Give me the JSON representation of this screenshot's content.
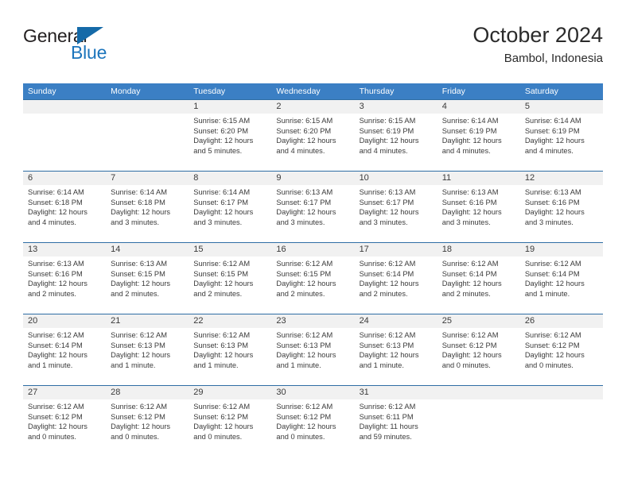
{
  "brand": {
    "name_top": "General",
    "name_bottom": "Blue",
    "flag_icon": "triangle-flag-icon",
    "color_dark": "#231f20",
    "color_blue": "#1c75bc"
  },
  "header": {
    "title": "October 2024",
    "subtitle": "Bambol, Indonesia"
  },
  "colors": {
    "header_row_bg": "#3b7fc4",
    "row_separator": "#2e6da4",
    "day_band_bg": "#f1f1f1",
    "text": "#3a3a3a"
  },
  "weekdays": [
    "Sunday",
    "Monday",
    "Tuesday",
    "Wednesday",
    "Thursday",
    "Friday",
    "Saturday"
  ],
  "weeks": [
    [
      {
        "day": "",
        "sunrise": "",
        "sunset": "",
        "daylight_line1": "",
        "daylight_line2": "",
        "empty": true
      },
      {
        "day": "",
        "sunrise": "",
        "sunset": "",
        "daylight_line1": "",
        "daylight_line2": "",
        "empty": true
      },
      {
        "day": "1",
        "sunrise": "Sunrise: 6:15 AM",
        "sunset": "Sunset: 6:20 PM",
        "daylight_line1": "Daylight: 12 hours",
        "daylight_line2": "and 5 minutes."
      },
      {
        "day": "2",
        "sunrise": "Sunrise: 6:15 AM",
        "sunset": "Sunset: 6:20 PM",
        "daylight_line1": "Daylight: 12 hours",
        "daylight_line2": "and 4 minutes."
      },
      {
        "day": "3",
        "sunrise": "Sunrise: 6:15 AM",
        "sunset": "Sunset: 6:19 PM",
        "daylight_line1": "Daylight: 12 hours",
        "daylight_line2": "and 4 minutes."
      },
      {
        "day": "4",
        "sunrise": "Sunrise: 6:14 AM",
        "sunset": "Sunset: 6:19 PM",
        "daylight_line1": "Daylight: 12 hours",
        "daylight_line2": "and 4 minutes."
      },
      {
        "day": "5",
        "sunrise": "Sunrise: 6:14 AM",
        "sunset": "Sunset: 6:19 PM",
        "daylight_line1": "Daylight: 12 hours",
        "daylight_line2": "and 4 minutes."
      }
    ],
    [
      {
        "day": "6",
        "sunrise": "Sunrise: 6:14 AM",
        "sunset": "Sunset: 6:18 PM",
        "daylight_line1": "Daylight: 12 hours",
        "daylight_line2": "and 4 minutes."
      },
      {
        "day": "7",
        "sunrise": "Sunrise: 6:14 AM",
        "sunset": "Sunset: 6:18 PM",
        "daylight_line1": "Daylight: 12 hours",
        "daylight_line2": "and 3 minutes."
      },
      {
        "day": "8",
        "sunrise": "Sunrise: 6:14 AM",
        "sunset": "Sunset: 6:17 PM",
        "daylight_line1": "Daylight: 12 hours",
        "daylight_line2": "and 3 minutes."
      },
      {
        "day": "9",
        "sunrise": "Sunrise: 6:13 AM",
        "sunset": "Sunset: 6:17 PM",
        "daylight_line1": "Daylight: 12 hours",
        "daylight_line2": "and 3 minutes."
      },
      {
        "day": "10",
        "sunrise": "Sunrise: 6:13 AM",
        "sunset": "Sunset: 6:17 PM",
        "daylight_line1": "Daylight: 12 hours",
        "daylight_line2": "and 3 minutes."
      },
      {
        "day": "11",
        "sunrise": "Sunrise: 6:13 AM",
        "sunset": "Sunset: 6:16 PM",
        "daylight_line1": "Daylight: 12 hours",
        "daylight_line2": "and 3 minutes."
      },
      {
        "day": "12",
        "sunrise": "Sunrise: 6:13 AM",
        "sunset": "Sunset: 6:16 PM",
        "daylight_line1": "Daylight: 12 hours",
        "daylight_line2": "and 3 minutes."
      }
    ],
    [
      {
        "day": "13",
        "sunrise": "Sunrise: 6:13 AM",
        "sunset": "Sunset: 6:16 PM",
        "daylight_line1": "Daylight: 12 hours",
        "daylight_line2": "and 2 minutes."
      },
      {
        "day": "14",
        "sunrise": "Sunrise: 6:13 AM",
        "sunset": "Sunset: 6:15 PM",
        "daylight_line1": "Daylight: 12 hours",
        "daylight_line2": "and 2 minutes."
      },
      {
        "day": "15",
        "sunrise": "Sunrise: 6:12 AM",
        "sunset": "Sunset: 6:15 PM",
        "daylight_line1": "Daylight: 12 hours",
        "daylight_line2": "and 2 minutes."
      },
      {
        "day": "16",
        "sunrise": "Sunrise: 6:12 AM",
        "sunset": "Sunset: 6:15 PM",
        "daylight_line1": "Daylight: 12 hours",
        "daylight_line2": "and 2 minutes."
      },
      {
        "day": "17",
        "sunrise": "Sunrise: 6:12 AM",
        "sunset": "Sunset: 6:14 PM",
        "daylight_line1": "Daylight: 12 hours",
        "daylight_line2": "and 2 minutes."
      },
      {
        "day": "18",
        "sunrise": "Sunrise: 6:12 AM",
        "sunset": "Sunset: 6:14 PM",
        "daylight_line1": "Daylight: 12 hours",
        "daylight_line2": "and 2 minutes."
      },
      {
        "day": "19",
        "sunrise": "Sunrise: 6:12 AM",
        "sunset": "Sunset: 6:14 PM",
        "daylight_line1": "Daylight: 12 hours",
        "daylight_line2": "and 1 minute."
      }
    ],
    [
      {
        "day": "20",
        "sunrise": "Sunrise: 6:12 AM",
        "sunset": "Sunset: 6:14 PM",
        "daylight_line1": "Daylight: 12 hours",
        "daylight_line2": "and 1 minute."
      },
      {
        "day": "21",
        "sunrise": "Sunrise: 6:12 AM",
        "sunset": "Sunset: 6:13 PM",
        "daylight_line1": "Daylight: 12 hours",
        "daylight_line2": "and 1 minute."
      },
      {
        "day": "22",
        "sunrise": "Sunrise: 6:12 AM",
        "sunset": "Sunset: 6:13 PM",
        "daylight_line1": "Daylight: 12 hours",
        "daylight_line2": "and 1 minute."
      },
      {
        "day": "23",
        "sunrise": "Sunrise: 6:12 AM",
        "sunset": "Sunset: 6:13 PM",
        "daylight_line1": "Daylight: 12 hours",
        "daylight_line2": "and 1 minute."
      },
      {
        "day": "24",
        "sunrise": "Sunrise: 6:12 AM",
        "sunset": "Sunset: 6:13 PM",
        "daylight_line1": "Daylight: 12 hours",
        "daylight_line2": "and 1 minute."
      },
      {
        "day": "25",
        "sunrise": "Sunrise: 6:12 AM",
        "sunset": "Sunset: 6:12 PM",
        "daylight_line1": "Daylight: 12 hours",
        "daylight_line2": "and 0 minutes."
      },
      {
        "day": "26",
        "sunrise": "Sunrise: 6:12 AM",
        "sunset": "Sunset: 6:12 PM",
        "daylight_line1": "Daylight: 12 hours",
        "daylight_line2": "and 0 minutes."
      }
    ],
    [
      {
        "day": "27",
        "sunrise": "Sunrise: 6:12 AM",
        "sunset": "Sunset: 6:12 PM",
        "daylight_line1": "Daylight: 12 hours",
        "daylight_line2": "and 0 minutes."
      },
      {
        "day": "28",
        "sunrise": "Sunrise: 6:12 AM",
        "sunset": "Sunset: 6:12 PM",
        "daylight_line1": "Daylight: 12 hours",
        "daylight_line2": "and 0 minutes."
      },
      {
        "day": "29",
        "sunrise": "Sunrise: 6:12 AM",
        "sunset": "Sunset: 6:12 PM",
        "daylight_line1": "Daylight: 12 hours",
        "daylight_line2": "and 0 minutes."
      },
      {
        "day": "30",
        "sunrise": "Sunrise: 6:12 AM",
        "sunset": "Sunset: 6:12 PM",
        "daylight_line1": "Daylight: 12 hours",
        "daylight_line2": "and 0 minutes."
      },
      {
        "day": "31",
        "sunrise": "Sunrise: 6:12 AM",
        "sunset": "Sunset: 6:11 PM",
        "daylight_line1": "Daylight: 11 hours",
        "daylight_line2": "and 59 minutes."
      },
      {
        "day": "",
        "sunrise": "",
        "sunset": "",
        "daylight_line1": "",
        "daylight_line2": "",
        "empty": true
      },
      {
        "day": "",
        "sunrise": "",
        "sunset": "",
        "daylight_line1": "",
        "daylight_line2": "",
        "empty": true
      }
    ]
  ]
}
